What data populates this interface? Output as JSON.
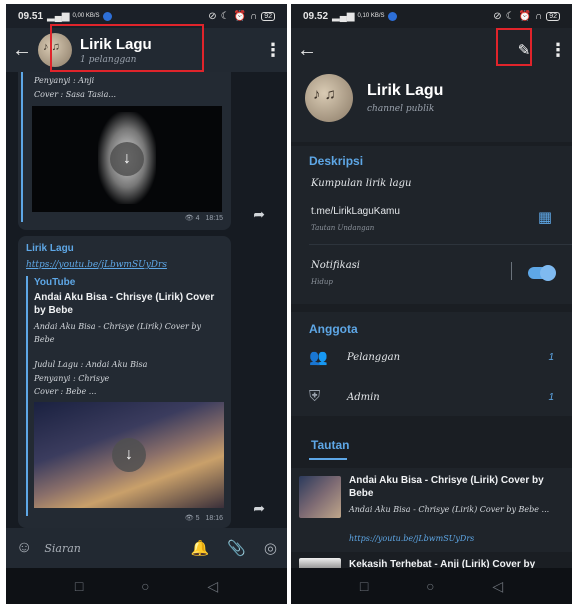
{
  "left": {
    "status": {
      "time": "09.51",
      "net": "0,00 KB/S",
      "battery": "92"
    },
    "header": {
      "title": "Lirik Lagu",
      "subtitle": "1 pelanggan"
    },
    "msg1": {
      "lines": [
        "Penyanyi      : Anji",
        "Cover            : Sasa Tasia..."
      ],
      "views": "4",
      "time": "18:15"
    },
    "msg2": {
      "channel": "Lirik Lagu",
      "url": "https://youtu.be/jLbwmSUyDrs",
      "site": "YouTube",
      "title": "Andai Aku Bisa - Chrisye (Lirik) Cover by Bebe",
      "desc": "Andai Aku Bisa - Chrisye (Lirik) Cover by Bebe",
      "lines": [
        "Judul Lagu : Andai Aku Bisa",
        "Penyanyi      : Chrisye",
        "Cover            : Bebe ..."
      ],
      "views": "5",
      "time": "18:16"
    },
    "input": {
      "placeholder": "Siaran"
    }
  },
  "right": {
    "status": {
      "time": "09.52",
      "net": "0,10 KB/S",
      "battery": "92"
    },
    "profile": {
      "title": "Lirik Lagu",
      "subtitle": "channel publik"
    },
    "desc": {
      "heading": "Deskripsi",
      "text": "Kumpulan lirik lagu",
      "link": "t.me/LirikLaguKamu",
      "link_label": "Tautan Undangan",
      "notif": "Notifikasi",
      "notif_state": "Hidup"
    },
    "members": {
      "heading": "Anggota",
      "subs_label": "Pelanggan",
      "subs_count": "1",
      "admin_label": "Admin",
      "admin_count": "1"
    },
    "links": {
      "tab": "Tautan",
      "items": [
        {
          "title": "Andai Aku Bisa - Chrisye (Lirik) Cover by Bebe",
          "desc": "Andai Aku Bisa - Chrisye (Lirik) Cover by Bebe ...",
          "url": "https://youtu.be/jLbwmSUyDrs"
        },
        {
          "title": "Kekasih Terhebat - Anji (Lirik) Cover by"
        }
      ]
    }
  },
  "colors": {
    "accent": "#5ea7e6",
    "highlight": "#e0242b",
    "bg": "#1b2028"
  }
}
